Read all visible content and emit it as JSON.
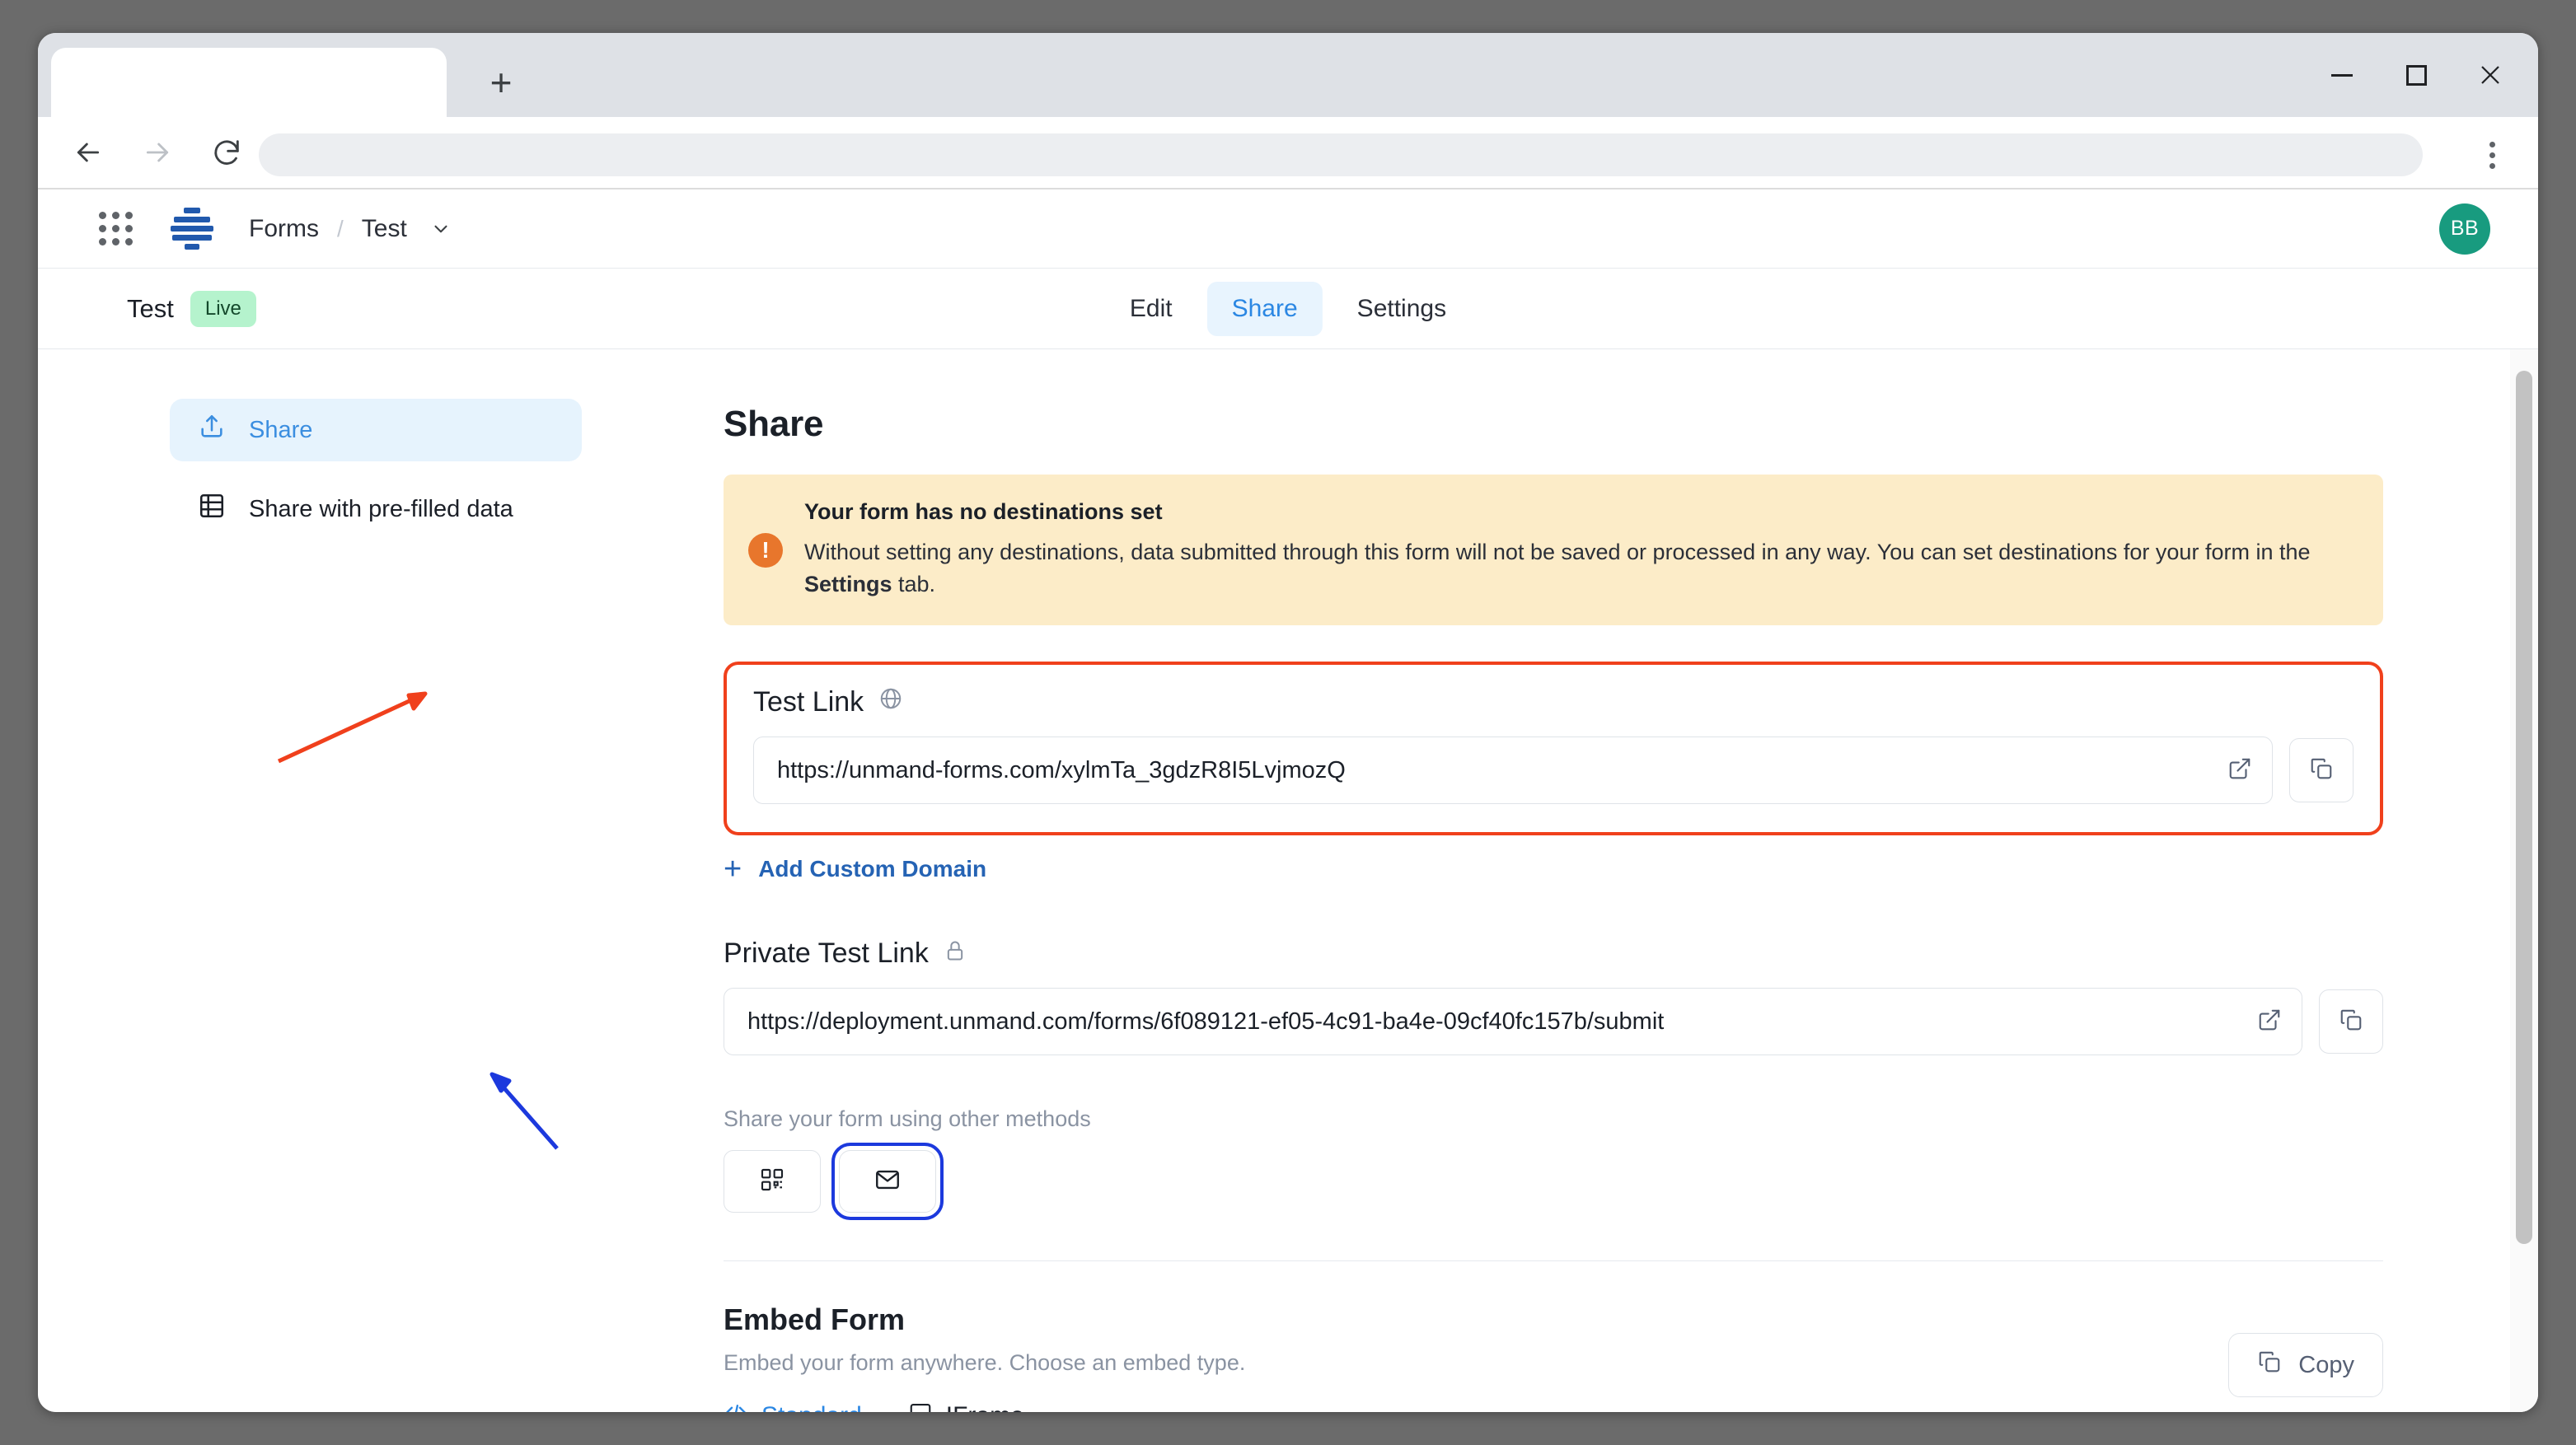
{
  "browser": {
    "tab_title": "",
    "new_tab_label": "+",
    "address_value": "",
    "window_controls": {
      "minimize": "minimize-icon",
      "maximize": "maximize-icon",
      "close": "close-icon"
    },
    "nav": {
      "back": "back-arrow-icon",
      "forward": "forward-arrow-icon",
      "reload": "reload-icon",
      "menu": "kebab-menu-icon"
    }
  },
  "app_header": {
    "apps_grid": "apps-grid-icon",
    "logo": "unmand-logo",
    "breadcrumb": {
      "product": "Forms",
      "separator": "/",
      "current": "Test",
      "chevron": "chevron-down-icon"
    },
    "avatar_initials": "BB"
  },
  "form_header": {
    "title": "Test",
    "status_badge": "Live",
    "tabs": [
      {
        "label": "Edit",
        "active": false
      },
      {
        "label": "Share",
        "active": true
      },
      {
        "label": "Settings",
        "active": false
      }
    ]
  },
  "sidebar": {
    "items": [
      {
        "label": "Share",
        "icon": "share-upload-icon",
        "active": true
      },
      {
        "label": "Share with pre-filled data",
        "icon": "table-grid-icon",
        "active": false
      }
    ]
  },
  "main": {
    "heading": "Share",
    "warning": {
      "icon": "exclamation-circle-icon",
      "title": "Your form has no destinations set",
      "body_part1": "Without setting any destinations, data submitted through this form will not be saved or processed in any way. You can set destinations for your form in the ",
      "body_bold": "Settings",
      "body_part2": " tab.",
      "bg_color": "#fcecc8",
      "icon_color": "#e8762c"
    },
    "test_link": {
      "label": "Test Link",
      "label_icon": "globe-icon",
      "url": "https://unmand-forms.com/xylmTa_3gdzR8I5LvjmozQ",
      "open_icon": "external-link-icon",
      "copy_icon": "copy-icon",
      "highlight_color": "#f0401c"
    },
    "add_custom_domain": {
      "plus": "+",
      "label": "Add Custom Domain"
    },
    "private_link": {
      "label": "Private Test Link",
      "label_icon": "lock-icon",
      "url": "https://deployment.unmand.com/forms/6f089121-ef05-4c91-ba4e-09cf40fc157b/submit",
      "open_icon": "external-link-icon",
      "copy_icon": "copy-icon"
    },
    "other_methods": {
      "label": "Share your form using other methods",
      "buttons": [
        {
          "name": "qr-code-icon",
          "focused": false
        },
        {
          "name": "email-envelope-icon",
          "focused": true
        }
      ]
    },
    "embed": {
      "title": "Embed Form",
      "subtitle": "Embed your form anywhere. Choose an embed type.",
      "tabs": [
        {
          "label": "Standard",
          "icon": "code-brackets-icon",
          "active": true
        },
        {
          "label": "IFrame",
          "icon": "monitor-icon",
          "active": false
        }
      ],
      "copy_button": {
        "label": "Copy",
        "icon": "copy-icon"
      }
    }
  },
  "annotations": {
    "red_arrow_color": "#f0401c",
    "blue_arrow_color": "#1c39dd"
  }
}
